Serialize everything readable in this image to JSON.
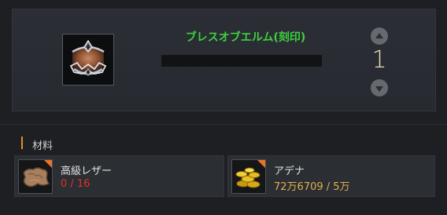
{
  "item": {
    "name": "ブレスオブエルム(刻印)",
    "quantity": "1",
    "icon": "crown-ring-icon"
  },
  "materials": {
    "title": "材料",
    "items": [
      {
        "name": "高級レザー",
        "count": "0 / 16",
        "count_color": "#e2302a",
        "icon": "leather-hide-icon"
      },
      {
        "name": "アデナ",
        "count": "72万6709 / 5万",
        "count_color": "#e3b24a",
        "icon": "gold-coins-icon"
      }
    ]
  },
  "colors": {
    "item_name": "#3fd13f",
    "quantity": "#e9dcb5",
    "accent": "#e08c2e"
  }
}
